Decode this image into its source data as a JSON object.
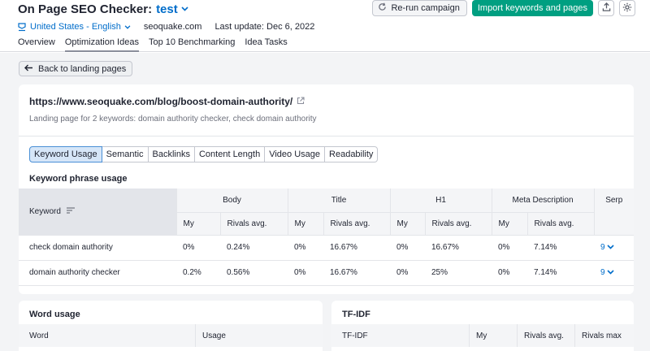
{
  "header": {
    "app_title": "On Page SEO Checker:",
    "project_name": "test",
    "location": "United States - English",
    "domain": "seoquake.com",
    "last_update": "Last update: Dec 6, 2022",
    "rerun_label": "Re-run campaign",
    "import_label": "Import keywords and pages",
    "tabs": [
      {
        "label": "Overview"
      },
      {
        "label": "Optimization Ideas"
      },
      {
        "label": "Top 10 Benchmarking"
      },
      {
        "label": "Idea Tasks"
      }
    ]
  },
  "back_label": "Back to landing pages",
  "page": {
    "url": "https://www.seoquake.com/blog/boost-domain-authority/",
    "subtitle": "Landing page for 2 keywords: domain authority checker, check domain authority"
  },
  "segments": [
    {
      "label": "Keyword Usage"
    },
    {
      "label": "Semantic"
    },
    {
      "label": "Backlinks"
    },
    {
      "label": "Content Length"
    },
    {
      "label": "Video Usage"
    },
    {
      "label": "Readability"
    }
  ],
  "keyword_section": {
    "title": "Keyword phrase usage",
    "keyword_header": "Keyword",
    "groups": [
      "Body",
      "Title",
      "H1",
      "Meta Description",
      "Serp"
    ],
    "sub_my": "My",
    "sub_rivals": "Rivals avg.",
    "rows": [
      {
        "keyword": "check domain authority",
        "body_my": "0%",
        "body_rivals": "0.24%",
        "title_my": "0%",
        "title_rivals": "16.67%",
        "h1_my": "0%",
        "h1_rivals": "16.67%",
        "meta_my": "0%",
        "meta_rivals": "7.14%",
        "serp": "9"
      },
      {
        "keyword": "domain authority checker",
        "body_my": "0.2%",
        "body_rivals": "0.56%",
        "title_my": "0%",
        "title_rivals": "16.67%",
        "h1_my": "0%",
        "h1_rivals": "25%",
        "meta_my": "0%",
        "meta_rivals": "7.14%",
        "serp": "9"
      }
    ]
  },
  "word_usage": {
    "title": "Word usage",
    "columns": [
      "Word",
      "Usage"
    ]
  },
  "tfidf": {
    "title": "TF-IDF",
    "columns": [
      "TF-IDF",
      "My",
      "Rivals avg.",
      "Rivals max"
    ]
  },
  "colors": {
    "brand_blue": "#006dca",
    "primary_green": "#009f81"
  }
}
